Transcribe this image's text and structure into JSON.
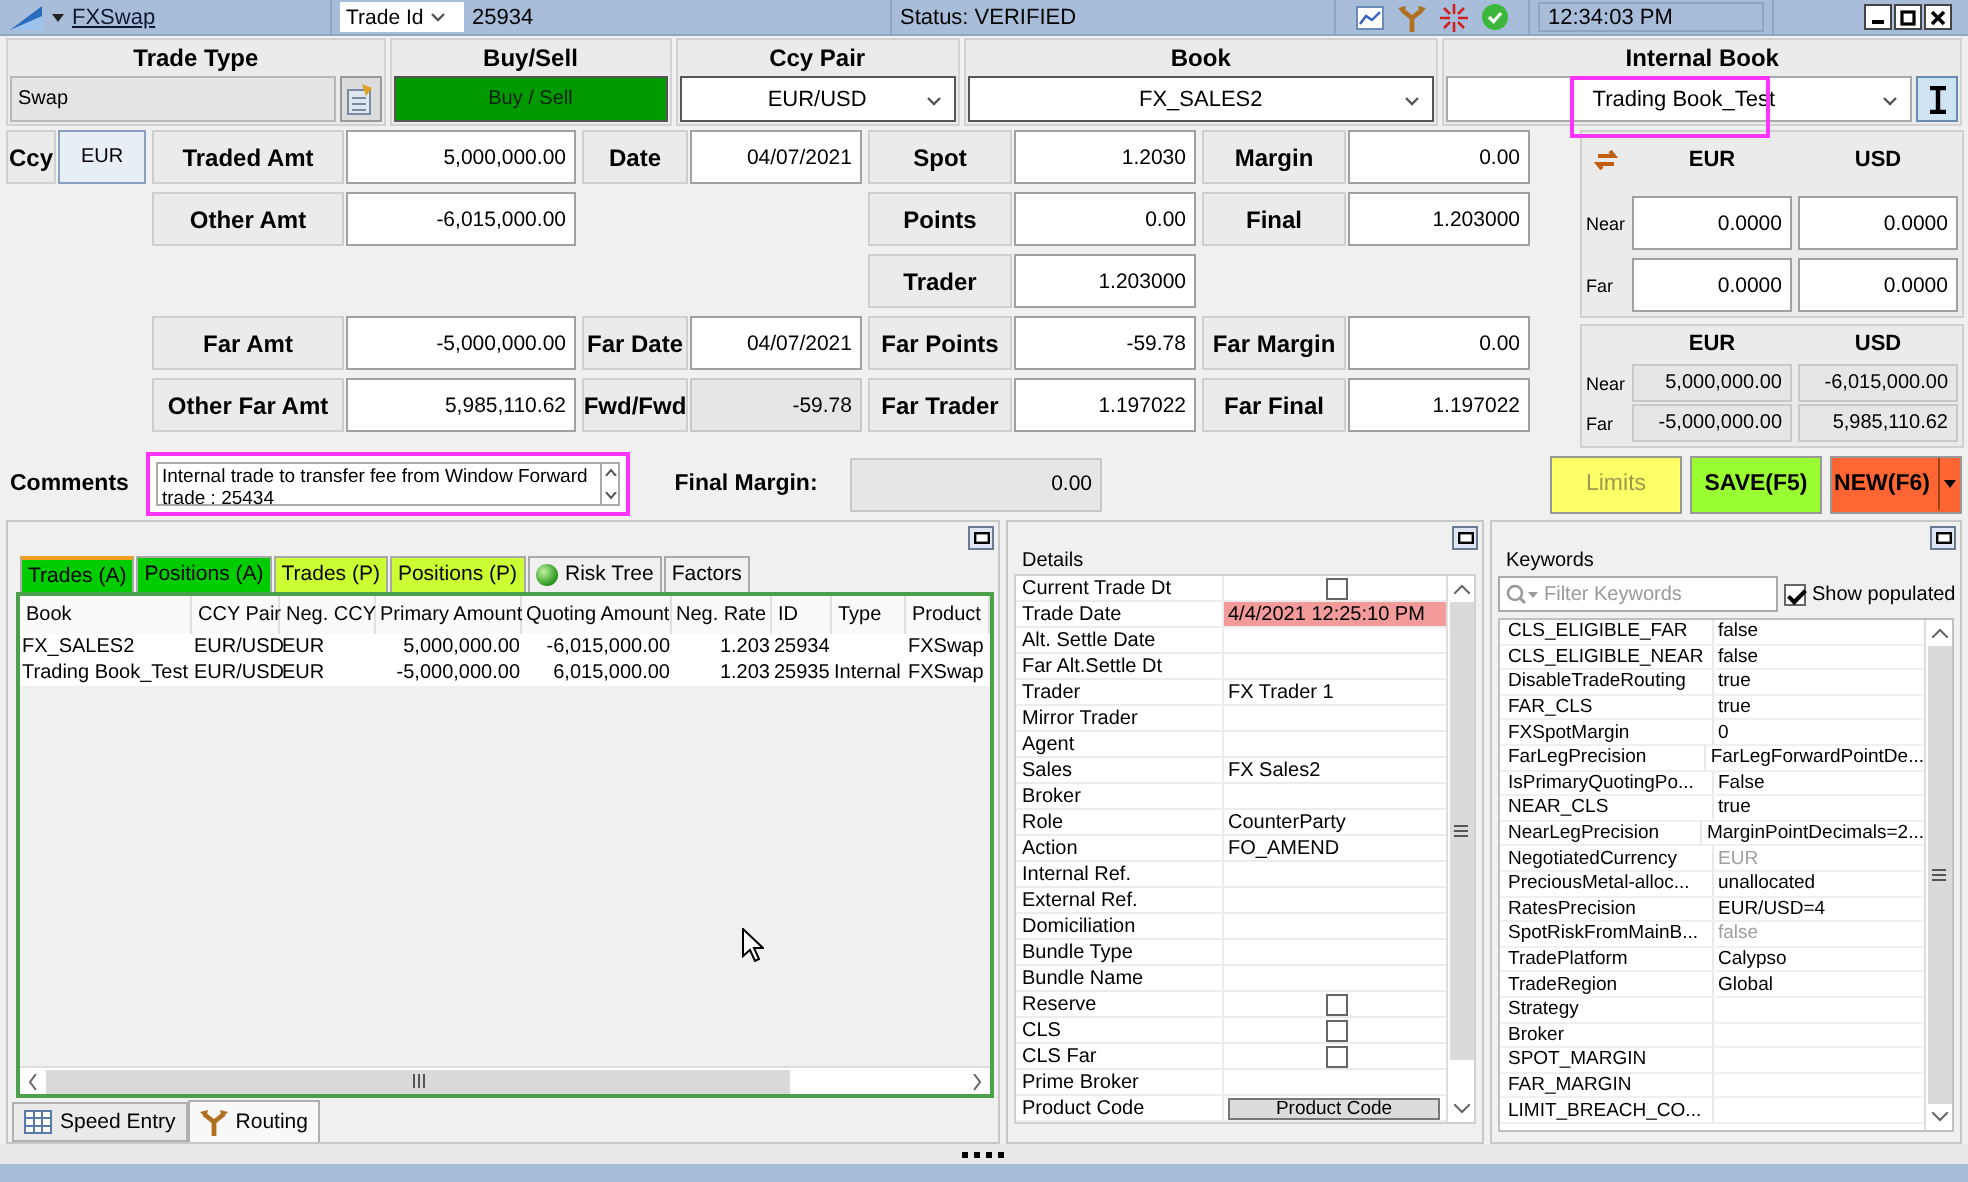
{
  "title_bar": {
    "trade_type": "FXSwap",
    "id_selector": "Trade Id",
    "trade_id": "25934",
    "status": "Status: VERIFIED",
    "time": "12:34:03 PM"
  },
  "header": {
    "trade_type": {
      "label": "Trade Type",
      "value": "Swap"
    },
    "buy_sell": {
      "label": "Buy/Sell",
      "button": "Buy / Sell"
    },
    "ccy_pair": {
      "label": "Ccy Pair",
      "value": "EUR/USD"
    },
    "book": {
      "label": "Book",
      "value": "FX_SALES2"
    },
    "internal_book": {
      "label": "Internal Book",
      "value": "Trading Book_Test",
      "highlighted": true
    }
  },
  "form": {
    "ccy": {
      "label": "Ccy",
      "value": "EUR"
    },
    "rows": [
      {
        "amount": {
          "label": "Traded Amt",
          "value": "5,000,000.00",
          "readonly": false
        },
        "date": {
          "label": "Date",
          "value": "04/07/2021",
          "readonly": false
        },
        "rate": {
          "label": "Spot",
          "value": "1.2030",
          "readonly": false
        },
        "margin": {
          "label": "Margin",
          "value": "0.00",
          "readonly": false
        }
      },
      {
        "amount": {
          "label": "Other Amt",
          "value": "-6,015,000.00",
          "readonly": false
        },
        "rate": {
          "label": "Points",
          "value": "0.00",
          "readonly": false
        },
        "margin": {
          "label": "Final",
          "value": "1.203000",
          "readonly": false
        }
      },
      {
        "rate": {
          "label": "Trader",
          "value": "1.203000",
          "readonly": false
        }
      },
      {
        "amount": {
          "label": "Far Amt",
          "value": "-5,000,000.00",
          "readonly": false
        },
        "date": {
          "label": "Far Date",
          "value": "04/07/2021",
          "readonly": false
        },
        "rate": {
          "label": "Far Points",
          "value": "-59.78",
          "readonly": false
        },
        "margin": {
          "label": "Far Margin",
          "value": "0.00",
          "readonly": false
        }
      },
      {
        "amount": {
          "label": "Other Far Amt",
          "value": "5,985,110.62",
          "readonly": false
        },
        "date": {
          "label": "Fwd/Fwd",
          "value": "-59.78",
          "readonly": true
        },
        "rate": {
          "label": "Far Trader",
          "value": "1.197022",
          "readonly": false
        },
        "margin": {
          "label": "Far Final",
          "value": "1.197022",
          "readonly": false
        }
      }
    ]
  },
  "near_far_rates": {
    "columns": [
      "EUR",
      "USD"
    ],
    "rows": [
      {
        "label": "Near",
        "values": [
          "0.0000",
          "0.0000"
        ]
      },
      {
        "label": "Far",
        "values": [
          "0.0000",
          "0.0000"
        ]
      }
    ]
  },
  "near_far_amounts": {
    "columns": [
      "EUR",
      "USD"
    ],
    "rows": [
      {
        "label": "Near",
        "values": [
          "5,000,000.00",
          "-6,015,000.00"
        ]
      },
      {
        "label": "Far",
        "values": [
          "-5,000,000.00",
          "5,985,110.62"
        ]
      }
    ]
  },
  "comments": {
    "label": "Comments",
    "value": "Internal trade to transfer fee from Window Forward trade : 25434",
    "highlighted": true
  },
  "final_margin": {
    "label": "Final Margin:",
    "value": "0.00"
  },
  "actions": [
    {
      "label": "Limits",
      "color": "#ffff66",
      "kind": "plain",
      "disabled": true
    },
    {
      "label": "SAVE(F5)",
      "color": "#99ff33",
      "kind": "plain",
      "disabled": false
    },
    {
      "label": "NEW(F6)",
      "color": "#ff6633",
      "kind": "split",
      "disabled": false
    }
  ],
  "trades_panel": {
    "tabs": [
      {
        "label": "Trades (A)",
        "color": "#00cc00",
        "kind": "plain",
        "selected": true
      },
      {
        "label": "Positions (A)",
        "color": "#00cc00",
        "kind": "plain",
        "selected": false
      },
      {
        "label": "Trades (P)",
        "color": "#ccff33",
        "kind": "plain",
        "selected": false
      },
      {
        "label": "Positions (P)",
        "color": "#ccff33",
        "kind": "plain",
        "selected": false
      },
      {
        "label": "Risk Tree",
        "color": "#f0f0f0",
        "kind": "status",
        "selected": false
      },
      {
        "label": "Factors",
        "color": "#f0f0f0",
        "kind": "plain",
        "selected": false
      }
    ],
    "table": {
      "columns": [
        {
          "label": "Book",
          "numeric": false
        },
        {
          "label": "CCY Pair",
          "numeric": false
        },
        {
          "label": "Neg. CCY",
          "numeric": false
        },
        {
          "label": "Primary Amount",
          "numeric": true
        },
        {
          "label": "Quoting Amount",
          "numeric": true
        },
        {
          "label": "Neg. Rate",
          "numeric": true
        },
        {
          "label": "ID",
          "numeric": false
        },
        {
          "label": "Type",
          "numeric": false
        },
        {
          "label": "Product",
          "numeric": false
        }
      ],
      "rows": [
        {
          "book": "FX_SALES2",
          "ccy_pair": "EUR/USD",
          "neg_ccy": "EUR",
          "primary_amount": "5,000,000.00",
          "quoting_amount": "-6,015,000.00",
          "neg_rate": "1.203",
          "id": "25934",
          "product": "FXSwap"
        },
        {
          "book": "Trading Book_Test",
          "ccy_pair": "EUR/USD",
          "neg_ccy": "EUR",
          "primary_amount": "-5,000,000.00",
          "quoting_amount": "6,015,000.00",
          "neg_rate": "1.203",
          "id": "25935",
          "type": "Internal",
          "product": "FXSwap"
        }
      ]
    },
    "bottom_tabs": [
      {
        "label": "Speed Entry",
        "kind": "grid",
        "selected": false
      },
      {
        "label": "Routing",
        "kind": "routing",
        "selected": true
      }
    ]
  },
  "details": {
    "title": "Details",
    "rows": [
      {
        "label": "Current Trade Dt",
        "kind": "checkbox",
        "checked": false
      },
      {
        "label": "Trade Date",
        "kind": "alert",
        "value": "4/4/2021 12:25:10 PM"
      },
      {
        "label": "Alt. Settle Date",
        "kind": "text"
      },
      {
        "label": "Far Alt.Settle Dt",
        "kind": "text"
      },
      {
        "label": "Trader",
        "kind": "text",
        "value": "FX Trader 1"
      },
      {
        "label": "Mirror Trader",
        "kind": "text"
      },
      {
        "label": "Agent",
        "kind": "text"
      },
      {
        "label": "Sales",
        "kind": "text",
        "value": "FX Sales2"
      },
      {
        "label": "Broker",
        "kind": "text"
      },
      {
        "label": "Role",
        "kind": "text",
        "value": "CounterParty"
      },
      {
        "label": "Action",
        "kind": "text",
        "value": "FO_AMEND"
      },
      {
        "label": "Internal Ref.",
        "kind": "text"
      },
      {
        "label": "External Ref.",
        "kind": "text"
      },
      {
        "label": "Domiciliation",
        "kind": "text"
      },
      {
        "label": "Bundle Type",
        "kind": "text"
      },
      {
        "label": "Bundle Name",
        "kind": "text"
      },
      {
        "label": "Reserve",
        "kind": "checkbox",
        "checked": false
      },
      {
        "label": "CLS",
        "kind": "checkbox",
        "checked": false
      },
      {
        "label": "CLS Far",
        "kind": "checkbox",
        "checked": false
      },
      {
        "label": "Prime Broker",
        "kind": "text"
      },
      {
        "label": "Product Code",
        "kind": "button",
        "value": "Product Code"
      }
    ]
  },
  "keywords": {
    "title": "Keywords",
    "filter": {
      "placeholder": "Filter Keywords"
    },
    "show_populated": {
      "label": "Show populated",
      "checked": true
    },
    "rows": [
      {
        "name": "CLS_ELIGIBLE_FAR",
        "value": "false",
        "inherited": false
      },
      {
        "name": "CLS_ELIGIBLE_NEAR",
        "value": "false",
        "inherited": false
      },
      {
        "name": "DisableTradeRouting",
        "value": "true",
        "inherited": false
      },
      {
        "name": "FAR_CLS",
        "value": "true",
        "inherited": false
      },
      {
        "name": "FXSpotMargin",
        "value": "0",
        "inherited": false
      },
      {
        "name": "FarLegPrecision",
        "value": "FarLegForwardPointDe...",
        "inherited": false
      },
      {
        "name": "IsPrimaryQuotingPo...",
        "value": "False",
        "inherited": false
      },
      {
        "name": "NEAR_CLS",
        "value": "true",
        "inherited": false
      },
      {
        "name": "NearLegPrecision",
        "value": "MarginPointDecimals=2...",
        "inherited": false
      },
      {
        "name": "NegotiatedCurrency",
        "value": "EUR",
        "inherited": true
      },
      {
        "name": "PreciousMetal-alloc...",
        "value": "unallocated",
        "inherited": false
      },
      {
        "name": "RatesPrecision",
        "value": "EUR/USD=4",
        "inherited": false
      },
      {
        "name": "SpotRiskFromMainB...",
        "value": "false",
        "inherited": true
      },
      {
        "name": "TradePlatform",
        "value": "Calypso",
        "inherited": false
      },
      {
        "name": "TradeRegion",
        "value": "Global",
        "inherited": false
      },
      {
        "name": "Strategy"
      },
      {
        "name": "Broker"
      },
      {
        "name": "SPOT_MARGIN"
      },
      {
        "name": "FAR_MARGIN"
      },
      {
        "name": "LIMIT_BREACH_CO..."
      }
    ]
  }
}
